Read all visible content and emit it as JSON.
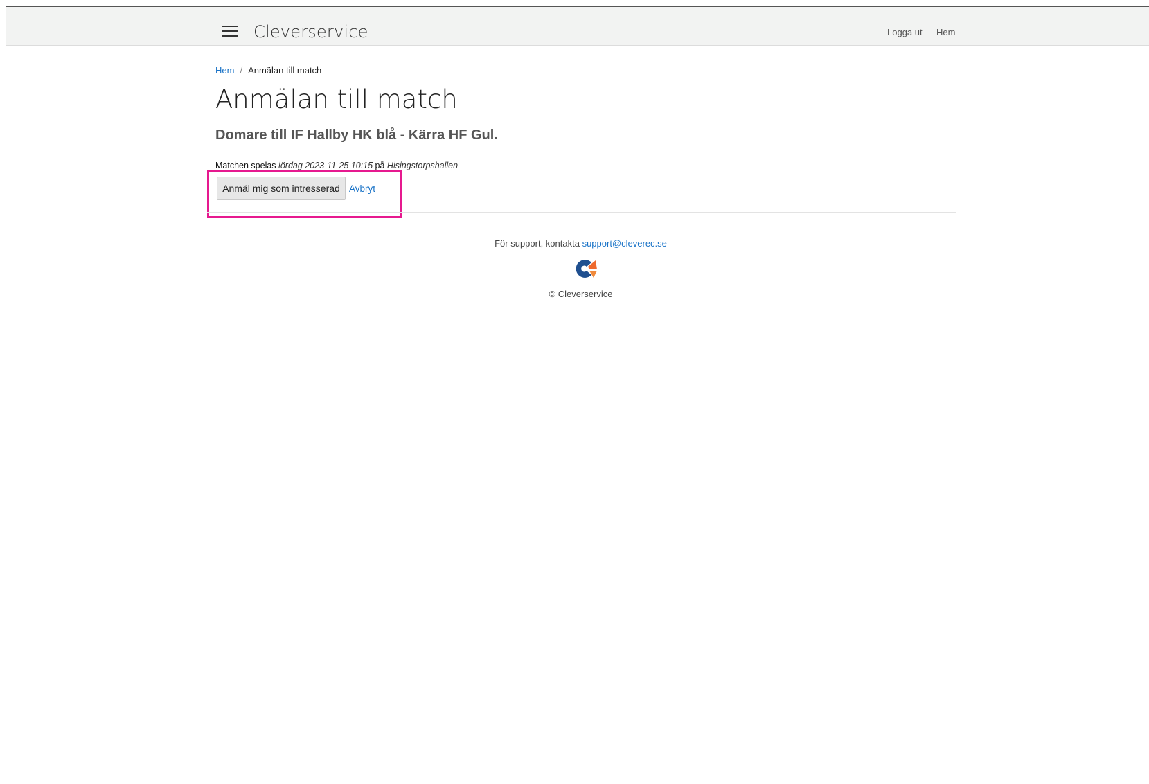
{
  "header": {
    "brand": "Cleverservice",
    "nav": {
      "logout": "Logga ut",
      "home": "Hem"
    }
  },
  "breadcrumb": {
    "home": "Hem",
    "separator": "/",
    "current": "Anmälan till match"
  },
  "page": {
    "title": "Anmälan till match",
    "subtitle": "Domare till IF Hallby HK blå - Kärra HF Gul.",
    "match_info": {
      "prefix": "Matchen spelas",
      "datetime": "lördag 2023-11-25 10:15",
      "connector": "på",
      "venue": "Hisingstorpshallen"
    },
    "actions": {
      "interest_button": "Anmäl mig som intresserad",
      "cancel_link": "Avbryt"
    }
  },
  "footer": {
    "support_text": "För support, kontakta",
    "support_email": "support@cleverec.se",
    "logo_icon": "cleverservice-logo-icon",
    "copyright": "© Cleverservice"
  },
  "colors": {
    "link": "#1a73c7",
    "highlight": "#e6198f",
    "topbar": "#f2f3f2"
  }
}
